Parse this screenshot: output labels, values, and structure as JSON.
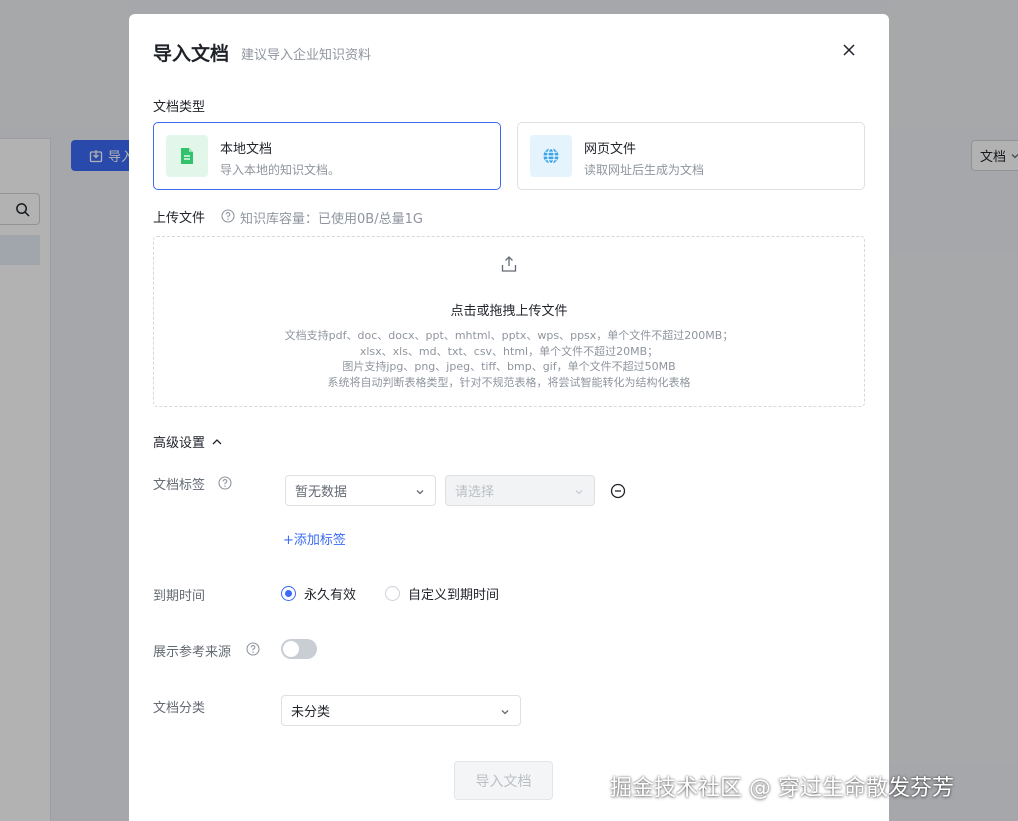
{
  "background": {
    "import_button_label": "导入",
    "type_select_label": "文档"
  },
  "modal": {
    "title": "导入文档",
    "subtitle": "建议导入企业知识资料",
    "doc_type": {
      "label": "文档类型",
      "options": [
        {
          "title": "本地文档",
          "desc": "导入本地的知识文档。",
          "icon": "document-icon",
          "selected": true
        },
        {
          "title": "网页文件",
          "desc": "读取网址后生成为文档",
          "icon": "globe-icon",
          "selected": false
        }
      ]
    },
    "upload": {
      "label": "上传文件",
      "capacity": "知识库容量：已使用0B/总量1G",
      "main": "点击或拖拽上传文件",
      "desc": [
        "文档支持pdf、doc、docx、ppt、mhtml、pptx、wps、ppsx，单个文件不超过200MB；",
        "xlsx、xls、md、txt、csv、html，单个文件不超过20MB；",
        "图片支持jpg、png、jpeg、tiff、bmp、gif，单个文件不超过50MB",
        "系统将自动判断表格类型，针对不规范表格，将尝试智能转化为结构化表格"
      ]
    },
    "advanced": {
      "label": "高级设置",
      "tags": {
        "label": "文档标签",
        "select1": "暂无数据",
        "select2_placeholder": "请选择",
        "add_label": "+添加标签"
      },
      "expiry": {
        "label": "到期时间",
        "options": [
          "永久有效",
          "自定义到期时间"
        ],
        "selected": "永久有效"
      },
      "show_source": {
        "label": "展示参考来源",
        "enabled": false
      },
      "category": {
        "label": "文档分类",
        "value": "未分类"
      }
    },
    "submit_label": "导入文档"
  },
  "watermark": "掘金技术社区 @ 穿过生命散发芬芳",
  "colors": {
    "accent": "#3b6bf5",
    "text": "#1f2329",
    "muted": "#8f959e"
  }
}
